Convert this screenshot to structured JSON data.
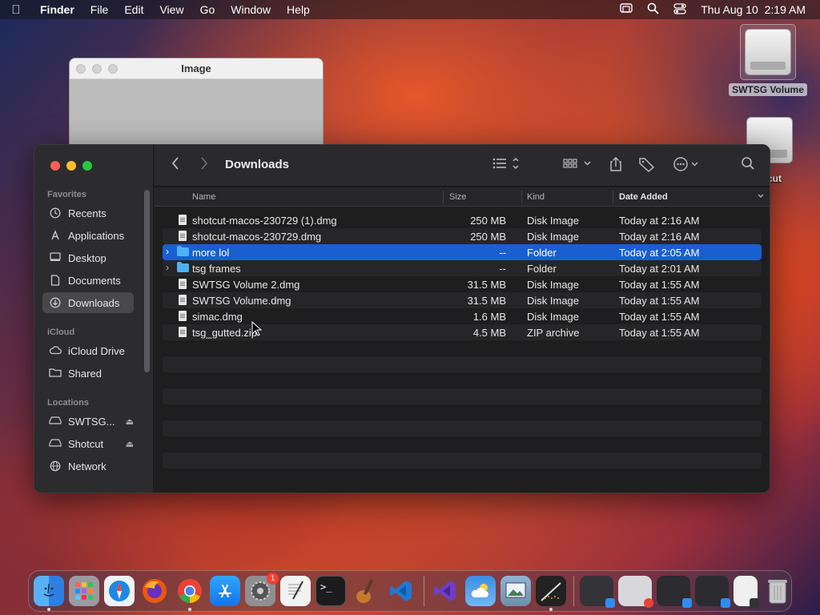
{
  "menubar": {
    "apple_icon": "apple-logo-icon",
    "items": [
      {
        "label": "Finder",
        "bold": true
      },
      {
        "label": "File"
      },
      {
        "label": "Edit"
      },
      {
        "label": "View"
      },
      {
        "label": "Go"
      },
      {
        "label": "Window"
      },
      {
        "label": "Help"
      }
    ],
    "status_icons": [
      "screen-mirroring-icon",
      "spotlight-search-icon",
      "control-center-icon"
    ],
    "datetime": "Thu Aug 10  2:19 AM"
  },
  "desktop": {
    "icons": [
      {
        "label": "SWTSG Volume",
        "icon": "external-disk-icon"
      },
      {
        "label": "cut",
        "icon": "external-disk-icon"
      }
    ]
  },
  "image_window": {
    "title": "Image"
  },
  "finder": {
    "title": "Downloads",
    "sidebar": {
      "favorites_label": "Favorites",
      "favorites": [
        {
          "label": "Recents",
          "icon": "clock-icon"
        },
        {
          "label": "Applications",
          "icon": "applications-icon"
        },
        {
          "label": "Desktop",
          "icon": "desktop-icon"
        },
        {
          "label": "Documents",
          "icon": "document-icon"
        },
        {
          "label": "Downloads",
          "icon": "download-icon",
          "active": true
        }
      ],
      "icloud_label": "iCloud",
      "icloud": [
        {
          "label": "iCloud Drive",
          "icon": "cloud-icon"
        },
        {
          "label": "Shared",
          "icon": "shared-folder-icon"
        }
      ],
      "locations_label": "Locations",
      "locations": [
        {
          "label": "SWTSG...",
          "icon": "drive-icon",
          "eject": true
        },
        {
          "label": "Shotcut",
          "icon": "drive-icon",
          "eject": true
        },
        {
          "label": "Network",
          "icon": "globe-icon"
        }
      ]
    },
    "toolbar": {
      "back_icon": "chevron-left-icon",
      "forward_icon": "chevron-right-icon",
      "view_list_icon": "list-view-icon",
      "group_icon": "grid-group-icon",
      "share_icon": "share-icon",
      "tag_icon": "tag-icon",
      "more_icon": "ellipsis-circle-icon",
      "search_icon": "search-icon"
    },
    "columns": {
      "name": "Name",
      "size": "Size",
      "kind": "Kind",
      "date": "Date Added"
    },
    "files": [
      {
        "name": "shotcut-macos-230729 (1).dmg",
        "size": "250 MB",
        "kind": "Disk Image",
        "date": "Today at 2:16 AM",
        "type": "file"
      },
      {
        "name": "shotcut-macos-230729.dmg",
        "size": "250 MB",
        "kind": "Disk Image",
        "date": "Today at 2:16 AM",
        "type": "file"
      },
      {
        "name": "more lol",
        "size": "--",
        "kind": "Folder",
        "date": "Today at 2:05 AM",
        "type": "folder",
        "selected": true
      },
      {
        "name": "tsg frames",
        "size": "--",
        "kind": "Folder",
        "date": "Today at 2:01 AM",
        "type": "folder"
      },
      {
        "name": "SWTSG Volume 2.dmg",
        "size": "31.5 MB",
        "kind": "Disk Image",
        "date": "Today at 1:55 AM",
        "type": "file"
      },
      {
        "name": "SWTSG Volume.dmg",
        "size": "31.5 MB",
        "kind": "Disk Image",
        "date": "Today at 1:55 AM",
        "type": "file"
      },
      {
        "name": "simac.dmg",
        "size": "1.6 MB",
        "kind": "Disk Image",
        "date": "Today at 1:55 AM",
        "type": "file"
      },
      {
        "name": "tsg_gutted.zip",
        "size": "4.5 MB",
        "kind": "ZIP archive",
        "date": "Today at 1:55 AM",
        "type": "file"
      }
    ]
  },
  "dock": {
    "apps": [
      {
        "name": "finder-icon",
        "color": "#2f8cf0",
        "running": true
      },
      {
        "name": "launchpad-icon",
        "color": "#8e8e93"
      },
      {
        "name": "safari-icon",
        "color": "#1e88e5"
      },
      {
        "name": "firefox-icon",
        "color": "#e8590c"
      },
      {
        "name": "chrome-icon",
        "color": "#e8e8e8",
        "running": true
      },
      {
        "name": "app-store-icon",
        "color": "#1c8ef9"
      },
      {
        "name": "system-settings-icon",
        "color": "#7c7c80",
        "badge": "1"
      },
      {
        "name": "textedit-icon",
        "color": "#f2f2f2"
      },
      {
        "name": "terminal-icon",
        "color": "#1c1c1e"
      },
      {
        "name": "garageband-icon",
        "color": "#5a3a22"
      },
      {
        "name": "vscode-icon",
        "color": "#1f78d1"
      }
    ],
    "apps2": [
      {
        "name": "visual-studio-icon",
        "color": "#6c3fc4"
      },
      {
        "name": "weather-icon",
        "color": "#3a8ee6"
      },
      {
        "name": "preview-icon",
        "color": "#6f8fa8"
      },
      {
        "name": "shotcut-icon",
        "color": "#222222",
        "running": true
      }
    ],
    "windows": [
      {
        "name": "minimized-window-icon",
        "color": "#333338"
      },
      {
        "name": "minimized-window-icon",
        "color": "#d8d8dc"
      },
      {
        "name": "minimized-window-icon",
        "color": "#2b2b30"
      },
      {
        "name": "minimized-window-icon",
        "color": "#2b2b30"
      },
      {
        "name": "minimized-window-icon",
        "color": "#f0f0f0"
      }
    ],
    "trash_icon": "trash-icon"
  }
}
